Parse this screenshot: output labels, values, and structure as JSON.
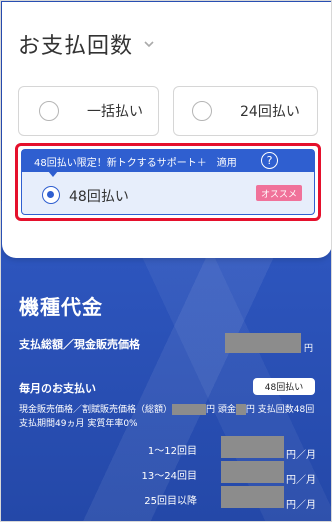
{
  "section": {
    "title": "お支払回数"
  },
  "options": [
    {
      "label": "一括払い"
    },
    {
      "label": "24回払い"
    }
  ],
  "selected": {
    "promo_text": "48回払い限定！新トクするサポート＋　適用",
    "help_icon": "?",
    "label": "48回払い",
    "badge": "オススメ"
  },
  "device_price": {
    "title": "機種代金",
    "total_label": "支払総額／現金販売価格",
    "total_unit": "円",
    "monthly_label": "毎月のお支払い",
    "monthly_pill": "48回払い",
    "desc_part1": "現金販売価格／割賦販売価格（総額）",
    "desc_part2": "円 頭金",
    "desc_part3": "円 支払回数48回 支払期間49ヵ月 実質年率0%",
    "periods": [
      {
        "label": "1〜12回目",
        "unit": "円／月"
      },
      {
        "label": "13〜24回目",
        "unit": "円／月"
      },
      {
        "label": "25回目以降",
        "unit": "円／月"
      }
    ]
  },
  "colors": {
    "accent_blue": "#2f5fd0",
    "highlight_red": "#e5102c",
    "badge_pink": "#f0729a",
    "section_bg": "#2a50b8"
  },
  "icons": {
    "title_chevron": "chevron-down-icon",
    "help": "question-circle-icon"
  }
}
